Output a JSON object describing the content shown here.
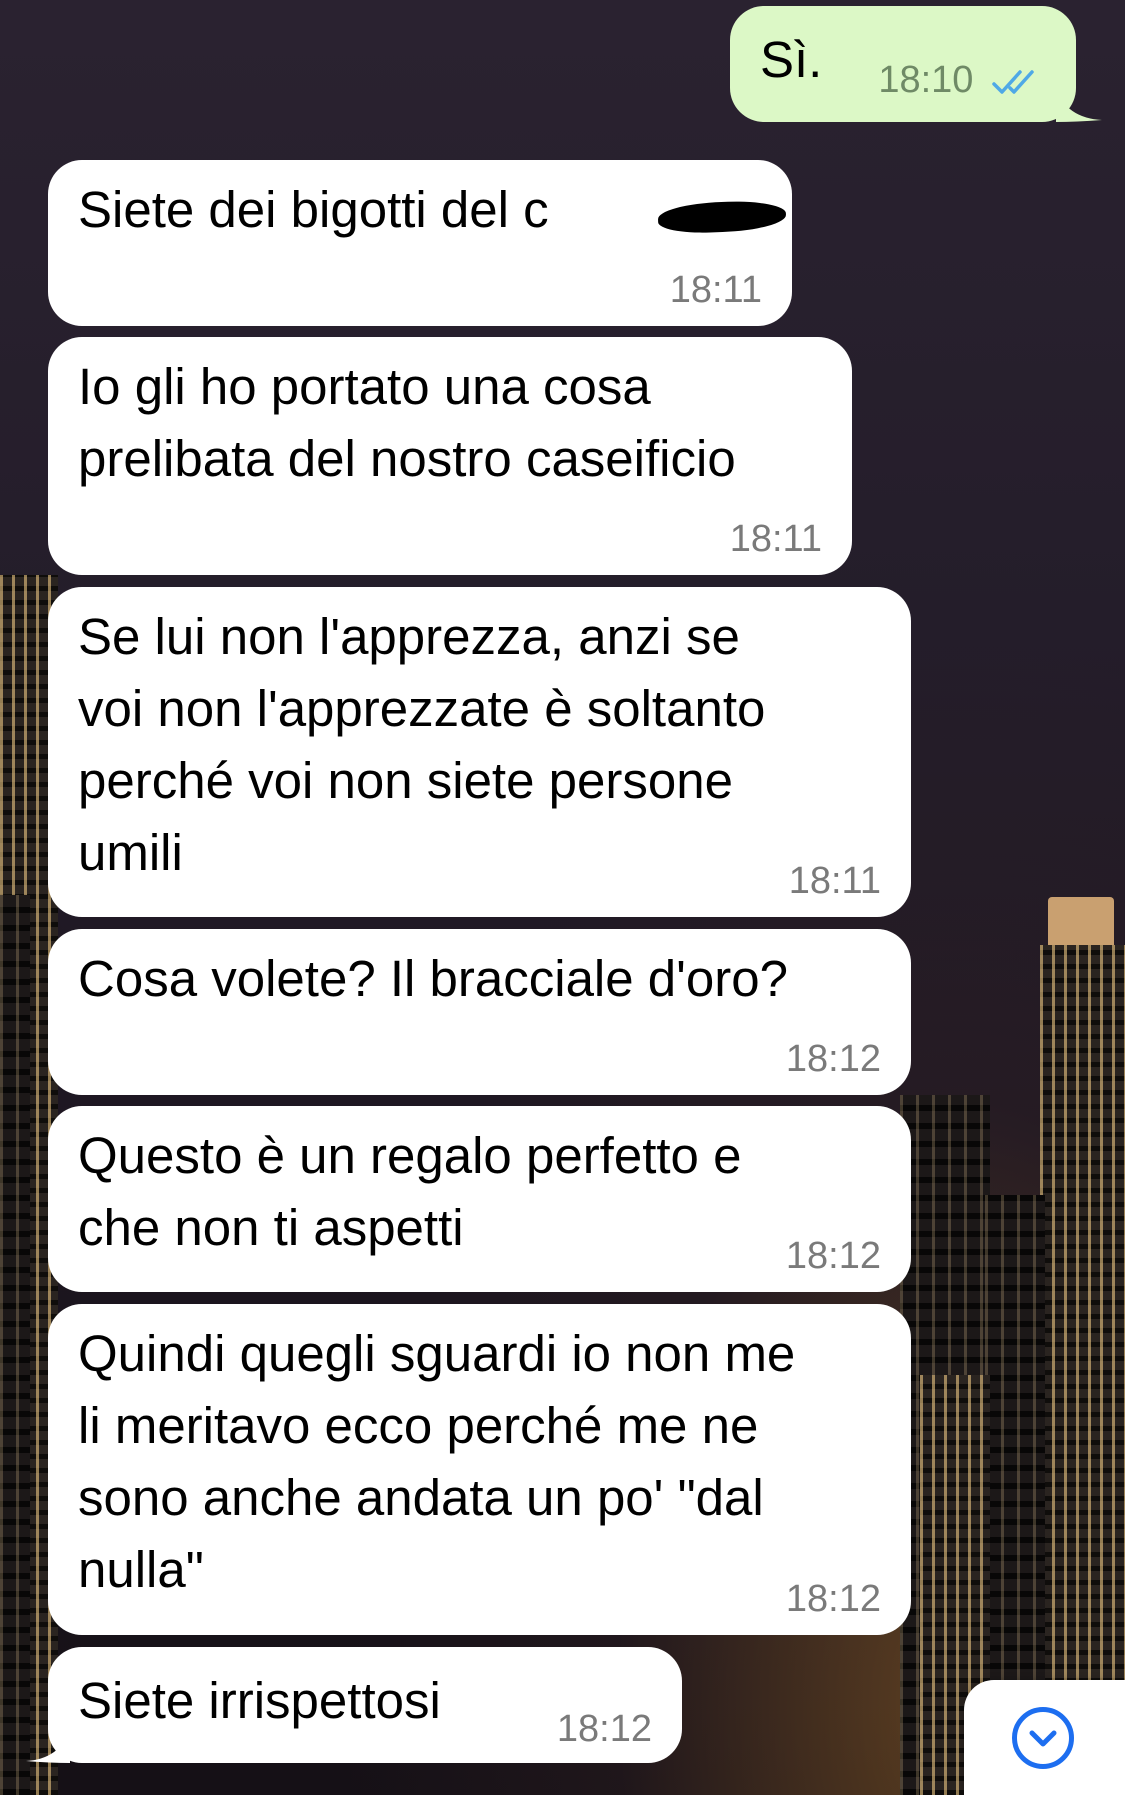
{
  "wallpaper": {
    "description_icon": "night-city-skyline"
  },
  "colors": {
    "incoming_bubble": "#ffffff",
    "outgoing_bubble": "#dcf8c6",
    "read_ticks": "#4fa9e6",
    "scroll_button_accent": "#1d6ef0",
    "timestamp": "#7a7a7a"
  },
  "messages": [
    {
      "direction": "out",
      "text": "Sì.",
      "time": "18:10",
      "status": "read"
    },
    {
      "direction": "in",
      "text": "Siete dei bigotti del c",
      "time": "18:11",
      "redacted": true
    },
    {
      "direction": "in",
      "text": "Io gli ho portato una cosa\nprelibata del nostro caseificio",
      "time": "18:11"
    },
    {
      "direction": "in",
      "text": "Se lui non l'apprezza, anzi se\nvoi non l'apprezzate è soltanto\nperché voi non siete persone\numili",
      "time": "18:11"
    },
    {
      "direction": "in",
      "text": "Cosa volete? Il bracciale d'oro?",
      "time": "18:12"
    },
    {
      "direction": "in",
      "text": "Questo è un regalo perfetto e\nche non ti aspetti",
      "time": "18:12"
    },
    {
      "direction": "in",
      "text": "Quindi quegli sguardi io non me\nli meritavo ecco perché me ne\nsono anche andata un po' \"dal\nnulla\"",
      "time": "18:12"
    },
    {
      "direction": "in",
      "text": "Siete irrispettosi",
      "time": "18:12"
    }
  ],
  "scroll_button": {
    "icon": "chevron-down-icon"
  }
}
